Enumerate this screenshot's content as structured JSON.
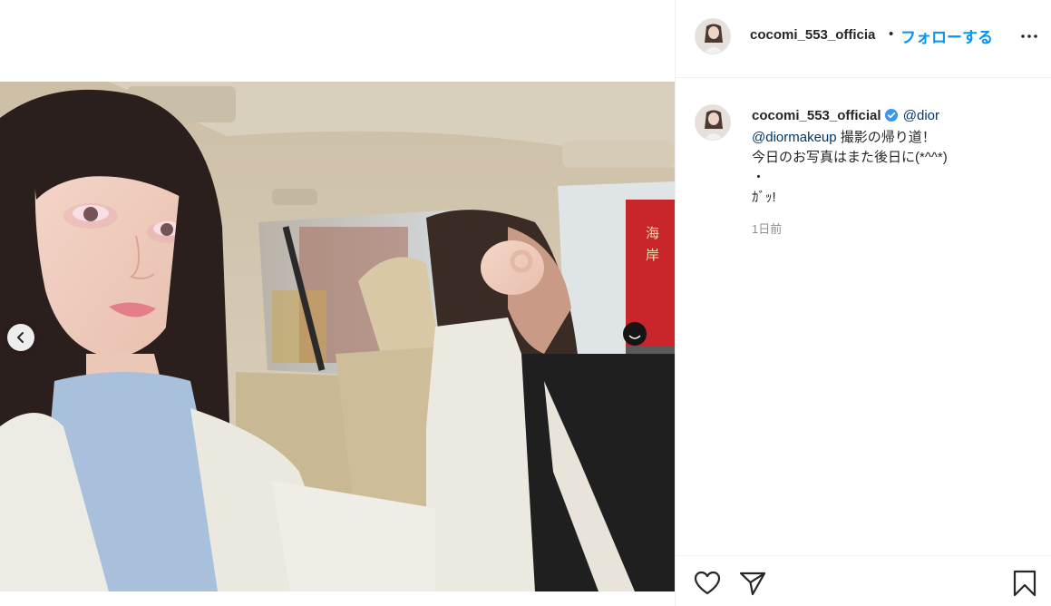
{
  "post": {
    "username": "cocomi_553_officia",
    "separator": "•",
    "follow_label": "フォローする",
    "more_icon": "more-horizontal-icon"
  },
  "caption": {
    "username": "cocomi_553_official",
    "verified_icon": "verified-badge-icon",
    "mention_1": "@dior",
    "mention_2": "@diormakeup",
    "line_1_rest": " 撮影の帰り道！",
    "line_2": "今日のお写真はまた後日に(*^^*)",
    "line_3": "・",
    "line_4": "ｶﾞｯ!",
    "timestamp": "1日前"
  },
  "actions": {
    "like_icon": "heart-icon",
    "share_icon": "paper-plane-icon",
    "save_icon": "bookmark-icon"
  },
  "media": {
    "prev_icon": "chevron-left-icon",
    "photo_sign_text": "海岸"
  },
  "colors": {
    "follow": "#0095f6",
    "mention": "#00376b",
    "timestamp": "#8e8e8e",
    "verified": "#3897f0",
    "divider": "#efefef"
  }
}
